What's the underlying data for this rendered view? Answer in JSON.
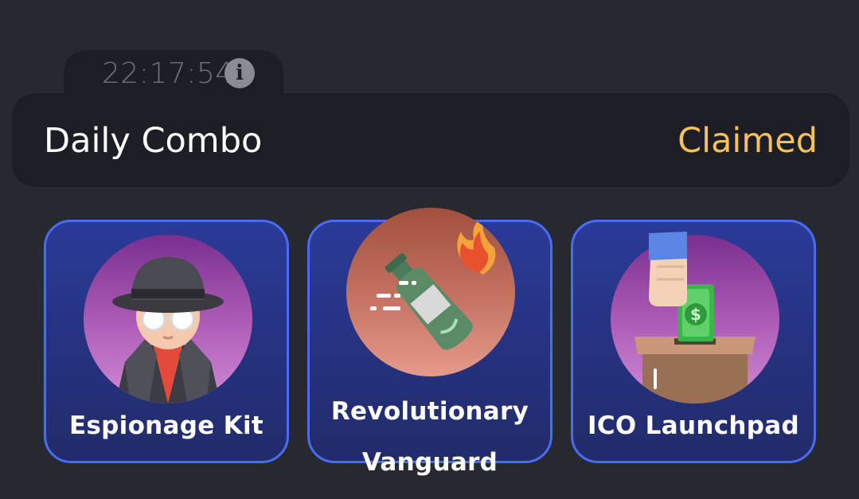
{
  "timer": {
    "time": "22:17:54",
    "info_icon": "info-icon"
  },
  "combo": {
    "title": "Daily Combo",
    "status": "Claimed",
    "status_color": "#f5c15a"
  },
  "cards": [
    {
      "label": "Espionage Kit",
      "icon": "spy-icon"
    },
    {
      "label": "Revolutionary Vanguard",
      "icon": "molotov-bottle-icon"
    },
    {
      "label": "ICO Launchpad",
      "icon": "ballot-box-money-icon"
    }
  ],
  "colors": {
    "background": "#272931",
    "panel": "#1d1e25",
    "card_border": "#4a6cf5",
    "card_fill": "#2a3a98"
  }
}
